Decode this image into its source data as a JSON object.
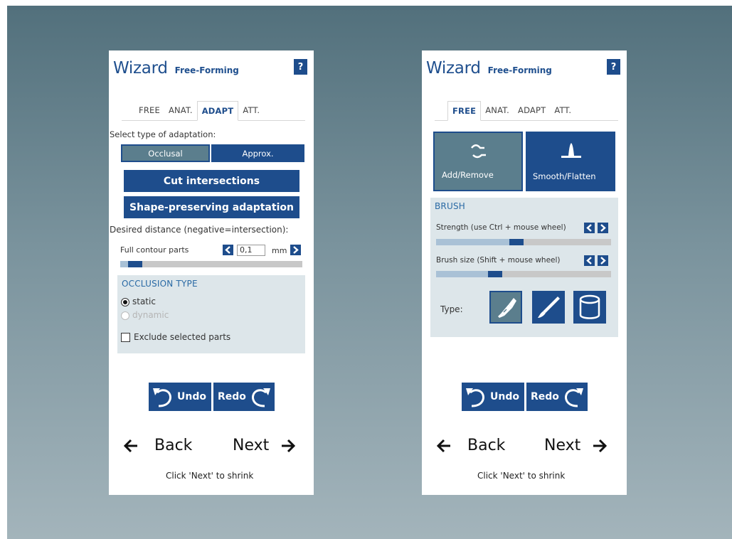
{
  "left": {
    "title": "Wizard",
    "subtitle": "Free-Forming",
    "help": "?",
    "tabs": [
      "FREE",
      "ANAT.",
      "ADAPT",
      "ATT."
    ],
    "active_tab": "ADAPT",
    "adaptation_label": "Select type of adaptation:",
    "occlusal": "Occlusal",
    "approx": "Approx.",
    "cut_intersections": "Cut intersections",
    "shape_preserving": "Shape-preserving adaptation",
    "distance_label": "Desired distance (negative=intersection):",
    "full_contour_label": "Full contour parts",
    "distance_value": "0,1",
    "distance_unit": "mm",
    "distance_slider_fraction": 0.12,
    "occlusion_head": "OCCLUSION TYPE",
    "static_label": "static",
    "dynamic_label": "dynamic",
    "exclude_label": "Exclude selected parts",
    "undo": "Undo",
    "redo": "Redo",
    "back": "Back",
    "next": "Next",
    "footer": "Click 'Next' to shrink"
  },
  "right": {
    "title": "Wizard",
    "subtitle": "Free-Forming",
    "help": "?",
    "tabs": [
      "FREE",
      "ANAT.",
      "ADAPT",
      "ATT."
    ],
    "active_tab": "FREE",
    "add_remove": "Add/Remove",
    "smooth_flatten": "Smooth/Flatten",
    "brush_head": "BRUSH",
    "strength_label": "Strength (use Ctrl + mouse wheel)",
    "strength_fraction": 0.5,
    "size_label": "Brush size (Shift + mouse wheel)",
    "size_fraction": 0.38,
    "type_label": "Type:",
    "undo": "Undo",
    "redo": "Redo",
    "back": "Back",
    "next": "Next",
    "footer": "Click 'Next' to shrink"
  },
  "colors": {
    "accent": "#1e4d8c",
    "selected": "#5b7e8d",
    "box": "#dde6ea"
  }
}
